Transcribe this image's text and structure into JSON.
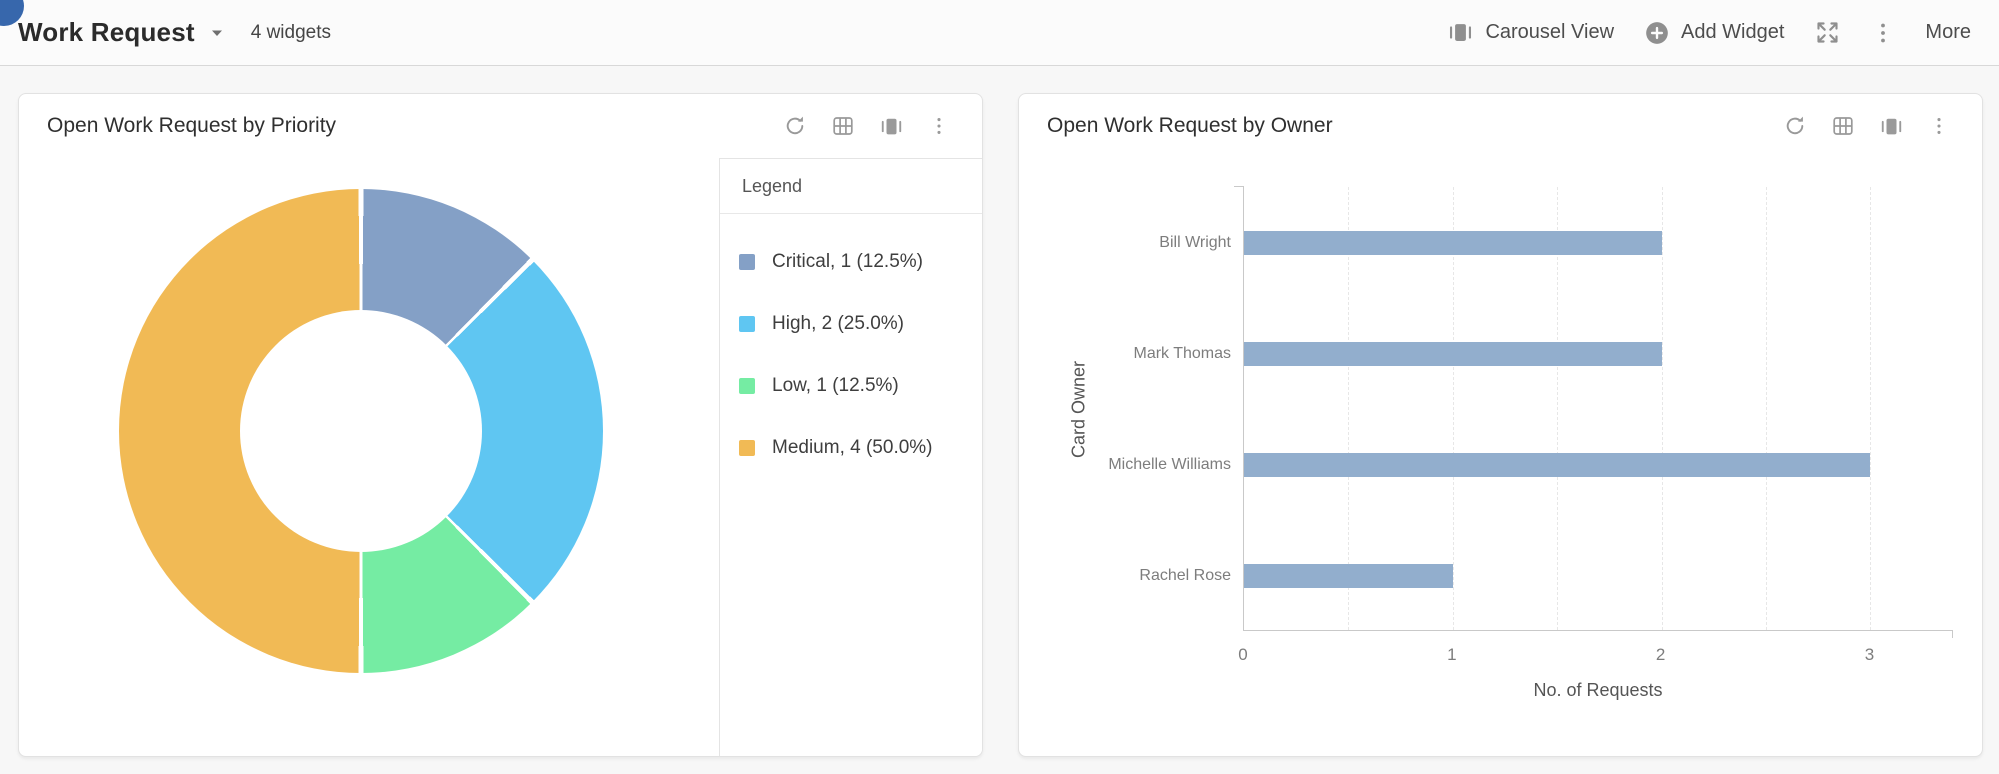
{
  "header": {
    "title": "Work Request",
    "widget_count": "4 widgets",
    "carousel_view": "Carousel View",
    "add_widget": "Add Widget",
    "more": "More"
  },
  "icons": {
    "caret": "triangle-down",
    "carousel": "panel-with-side-bars",
    "add": "plus-in-circle",
    "expand": "four-corner-arrows",
    "kebab": "three-vertical-dots",
    "refresh": "circular-arrow",
    "table": "grid-table"
  },
  "widgets": [
    {
      "title": "Open Work Request by Priority",
      "legend_title": "Legend"
    },
    {
      "title": "Open Work Request by Owner"
    }
  ],
  "chart_data": [
    {
      "type": "pie",
      "subtype": "donut",
      "title": "Open Work Request by Priority",
      "labels": [
        "Critical",
        "High",
        "Low",
        "Medium"
      ],
      "values": [
        1,
        2,
        1,
        4
      ],
      "percents": [
        12.5,
        25.0,
        12.5,
        50.0
      ],
      "colors": [
        "#84A0C6",
        "#5FC6F2",
        "#75ECA3",
        "#F1BA55"
      ],
      "legend_items": [
        {
          "label": "Critical, 1 (12.5%)",
          "color": "#84A0C6"
        },
        {
          "label": "High, 2 (25.0%)",
          "color": "#5FC6F2"
        },
        {
          "label": "Low, 1 (12.5%)",
          "color": "#75ECA3"
        },
        {
          "label": "Medium, 4 (50.0%)",
          "color": "#F1BA55"
        }
      ],
      "start_angle_deg": 0,
      "direction": "clockwise",
      "legend_position": "right-panel"
    },
    {
      "type": "bar",
      "orientation": "horizontal",
      "title": "Open Work Request by Owner",
      "categories": [
        "Bill Wright",
        "Mark Thomas",
        "Michelle Williams",
        "Rachel Rose"
      ],
      "values": [
        2,
        2,
        3,
        1
      ],
      "bar_color": "#92AECD",
      "xlabel": "No. of Requests",
      "ylabel": "Card Owner",
      "xticks": [
        0,
        1,
        2,
        3
      ],
      "xlim": [
        0,
        3.4
      ],
      "grid": "vertical dashed every 0.5"
    }
  ]
}
